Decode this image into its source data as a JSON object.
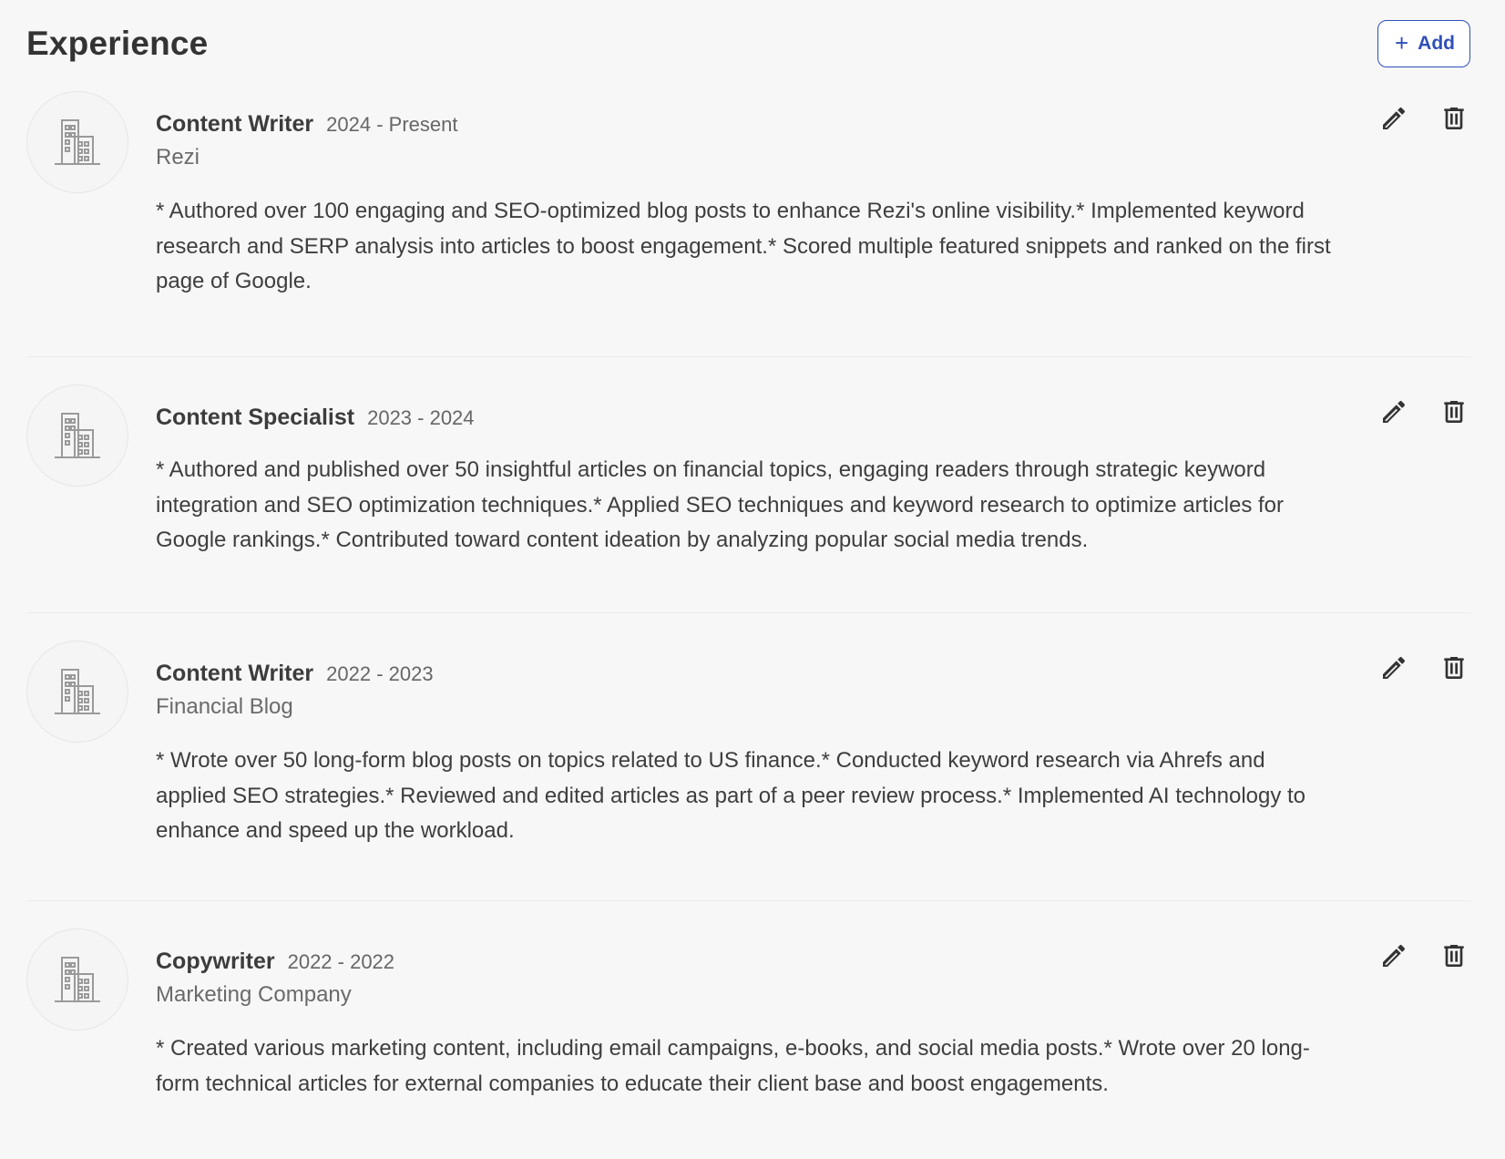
{
  "section": {
    "title": "Experience",
    "add_label": "Add"
  },
  "colors": {
    "accent": "#2f4fb8",
    "background": "#f7f7f7",
    "divider": "#ececec"
  },
  "icons": {
    "add": "plus-icon",
    "logo": "building-icon",
    "edit": "pencil-icon",
    "delete": "trash-icon"
  },
  "experiences": [
    {
      "role": "Content Writer",
      "dates": "2024 - Present",
      "company": "Rezi",
      "description": "* Authored over 100 engaging and SEO-optimized blog posts to enhance Rezi's online visibility.* Implemented keyword research and SERP analysis into articles to boost engagement.* Scored multiple featured snippets and ranked on the first page of Google."
    },
    {
      "role": "Content Specialist",
      "dates": "2023 - 2024",
      "company": "",
      "description": "* Authored and published over 50 insightful articles on financial topics, engaging readers through strategic keyword integration and SEO optimization techniques.* Applied SEO techniques and keyword research to optimize articles for Google rankings.* Contributed toward content ideation by analyzing popular social media trends."
    },
    {
      "role": "Content Writer",
      "dates": "2022 - 2023",
      "company": "Financial Blog",
      "description": "* Wrote over 50 long-form blog posts on topics related to US finance.* Conducted keyword research via Ahrefs and applied SEO strategies.* Reviewed and edited articles as part of a peer review process.* Implemented AI technology to enhance and speed up the workload."
    },
    {
      "role": "Copywriter",
      "dates": "2022 - 2022",
      "company": "Marketing Company",
      "description": "* Created various marketing content, including email campaigns, e-books, and social media posts.* Wrote over 20 long-form technical articles for external companies to educate their client base and boost engagements."
    }
  ]
}
